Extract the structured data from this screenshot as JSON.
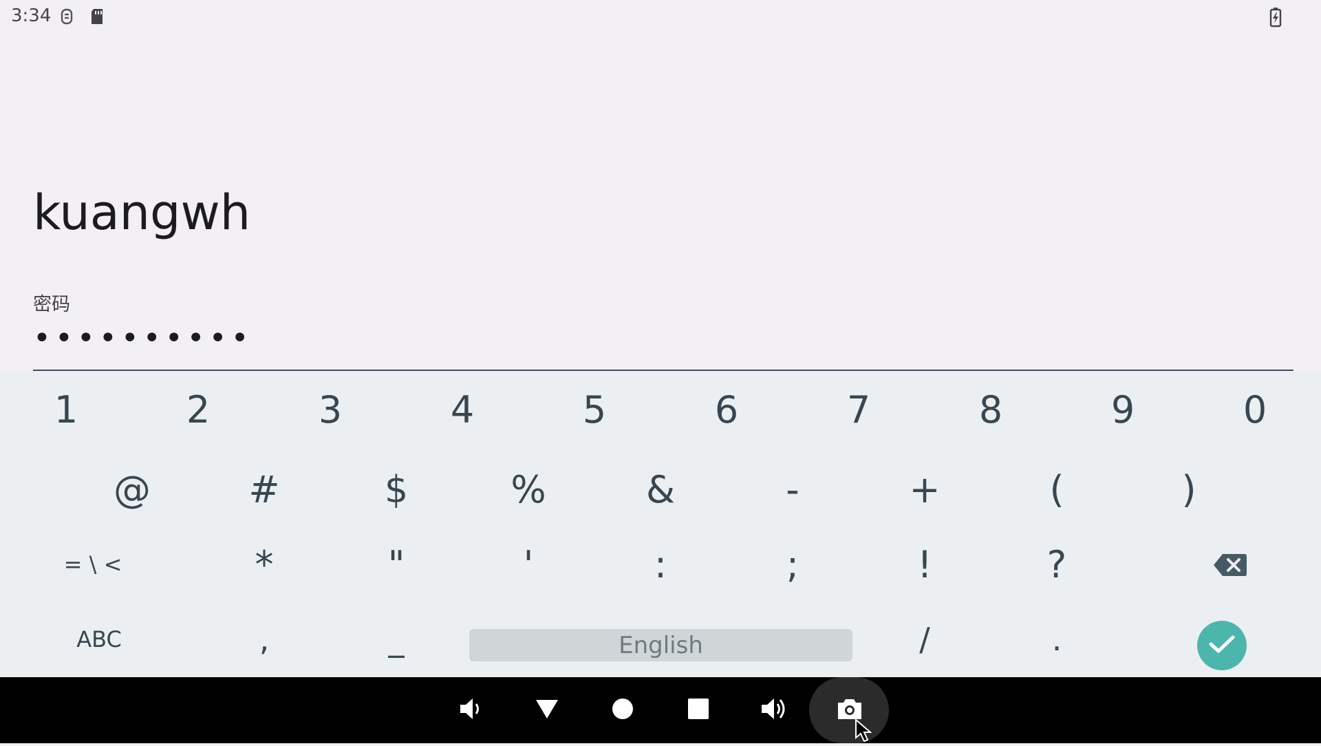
{
  "status_bar": {
    "time": "3:34",
    "icons": [
      "notification-icon",
      "sd-card-icon",
      "battery-charging-icon"
    ]
  },
  "form": {
    "username": "kuangwh",
    "password_label": "密码",
    "password_value": "••••••••••"
  },
  "keyboard": {
    "row1": [
      "1",
      "2",
      "3",
      "4",
      "5",
      "6",
      "7",
      "8",
      "9",
      "0"
    ],
    "row2": [
      "@",
      "#",
      "$",
      "%",
      "&",
      "-",
      "+",
      "(",
      ")"
    ],
    "row3": [
      "= \\ <",
      "*",
      "\"",
      "'",
      ":",
      ";",
      "!",
      "?"
    ],
    "row3_backspace_icon": "backspace-icon",
    "row4": {
      "abc": "ABC",
      "comma": ",",
      "underscore": "_",
      "space": "English",
      "slash": "/",
      "period": "."
    },
    "enter_icon": "check-icon",
    "accent_color": "#4db6ac"
  },
  "nav_bar": {
    "buttons": [
      "volume-down-icon",
      "back-icon",
      "home-icon",
      "recents-icon",
      "volume-up-icon",
      "screenshot-icon"
    ]
  }
}
